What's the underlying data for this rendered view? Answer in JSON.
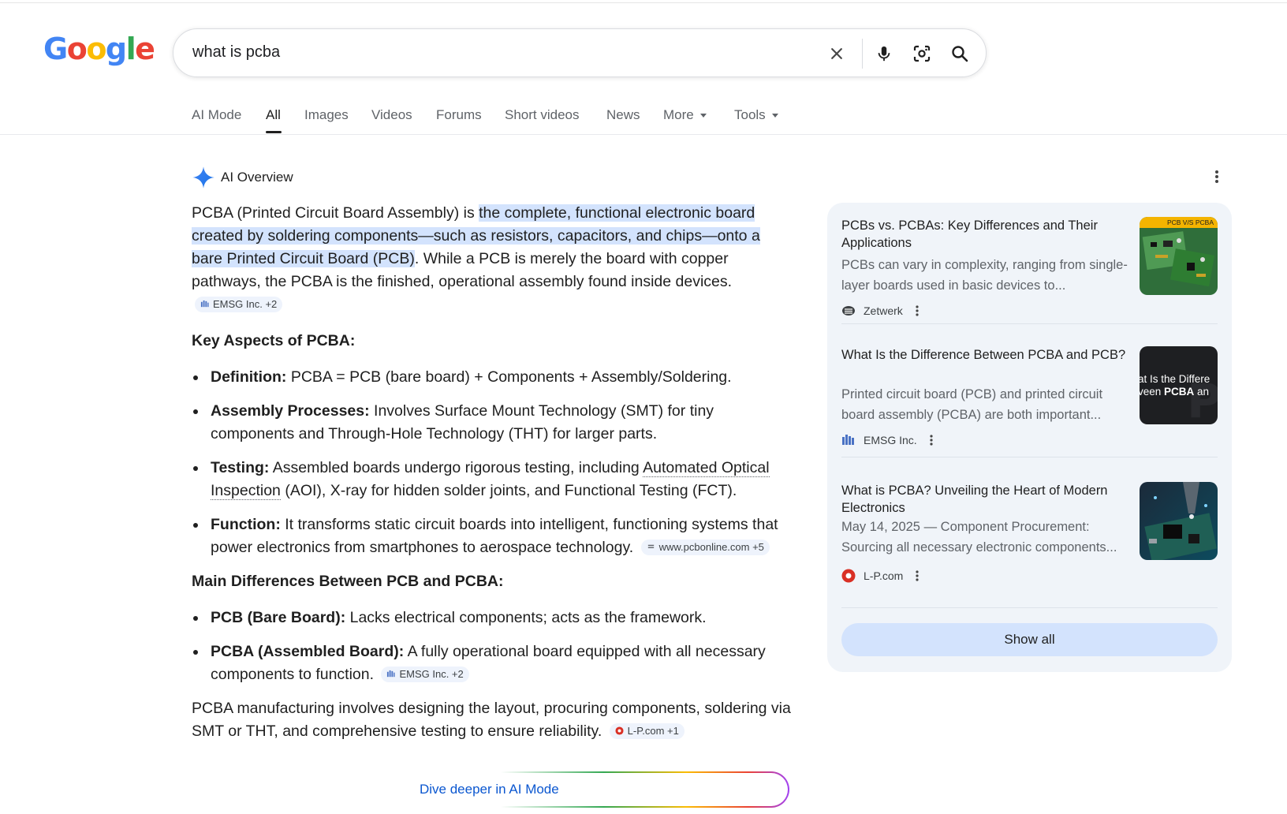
{
  "logo": {
    "letters": [
      "G",
      "o",
      "o",
      "g",
      "l",
      "e"
    ],
    "colors": [
      "#4285F4",
      "#EA4335",
      "#FBBC05",
      "#4285F4",
      "#34A853",
      "#EA4335"
    ]
  },
  "search": {
    "query": "what is pcba"
  },
  "tabs": [
    {
      "label": "AI Mode"
    },
    {
      "label": "All",
      "active": true
    },
    {
      "label": "Images"
    },
    {
      "label": "Videos"
    },
    {
      "label": "Forums"
    },
    {
      "label": "Short videos"
    },
    {
      "label": "News"
    },
    {
      "label": "More"
    },
    {
      "label": "Tools"
    }
  ],
  "ai_overview": {
    "label": "AI Overview",
    "intro": {
      "pre": "PCBA (Printed Circuit Board Assembly) is ",
      "highlight": "the complete, functional electronic board created by soldering components—such as resistors, capacitors, and chips—onto a bare Printed Circuit Board (PCB)",
      "post": ". While a PCB is merely the board with copper pathways, the PCBA is the finished, operational assembly found inside devices.",
      "chip": "EMSG Inc. +2"
    },
    "key_aspects": {
      "heading": "Key Aspects of PCBA:",
      "items": [
        {
          "term": "Definition:",
          "text": " PCBA = PCB (bare board) + Components + Assembly/Soldering."
        },
        {
          "term": "Assembly Processes:",
          "text": " Involves Surface Mount Technology (SMT) for tiny components and Through-Hole Technology (THT) for larger parts."
        },
        {
          "term": "Testing:",
          "pre": " Assembled boards undergo rigorous testing, including ",
          "link": "Automated Optical Inspection",
          "post": " (AOI), X-ray for hidden solder joints, and Functional Testing (FCT)."
        },
        {
          "term": "Function:",
          "text": " It transforms static circuit boards into intelligent, functioning systems that power electronics from smartphones to aerospace technology.",
          "chip": "www.pcbonline.com +5"
        }
      ]
    },
    "differences": {
      "heading": "Main Differences Between PCB and PCBA:",
      "items": [
        {
          "term": "PCB (Bare Board):",
          "text": " Lacks electrical components; acts as the framework."
        },
        {
          "term": "PCBA (Assembled Board):",
          "text": " A fully operational board equipped with all necessary components to function.",
          "chip": "EMSG Inc. +2"
        }
      ]
    },
    "closing": {
      "text": "PCBA manufacturing involves designing the layout, procuring components, soldering via SMT or THT, and comprehensive testing to ensure reliability.",
      "chip": "L-P.com +1"
    },
    "dive_deeper": "Dive deeper in AI Mode"
  },
  "sources": [
    {
      "title": "PCBs vs. PCBAs: Key Differences and Their Applications",
      "snippet": "PCBs can vary in complexity, ranging from single-layer boards used in basic devices to...",
      "site": "Zetwerk",
      "thumb_label": "PCB V/S PCBA"
    },
    {
      "title": "What Is the Difference Between PCBA and PCB?",
      "snippet": "Printed circuit board (PCB) and printed circuit board assembly (PCBA) are both important...",
      "site": "EMSG Inc.",
      "thumb_line1": "at Is the Differe",
      "thumb_line2_pre": "veen ",
      "thumb_line2_bold": "PCBA",
      "thumb_line2_post": " an"
    },
    {
      "title": "What is PCBA? Unveiling the Heart of Modern Electronics",
      "snippet": "May 14, 2025 — Component Procurement: Sourcing all necessary electronic components...",
      "site": "L-P.com"
    }
  ],
  "show_all": "Show all"
}
